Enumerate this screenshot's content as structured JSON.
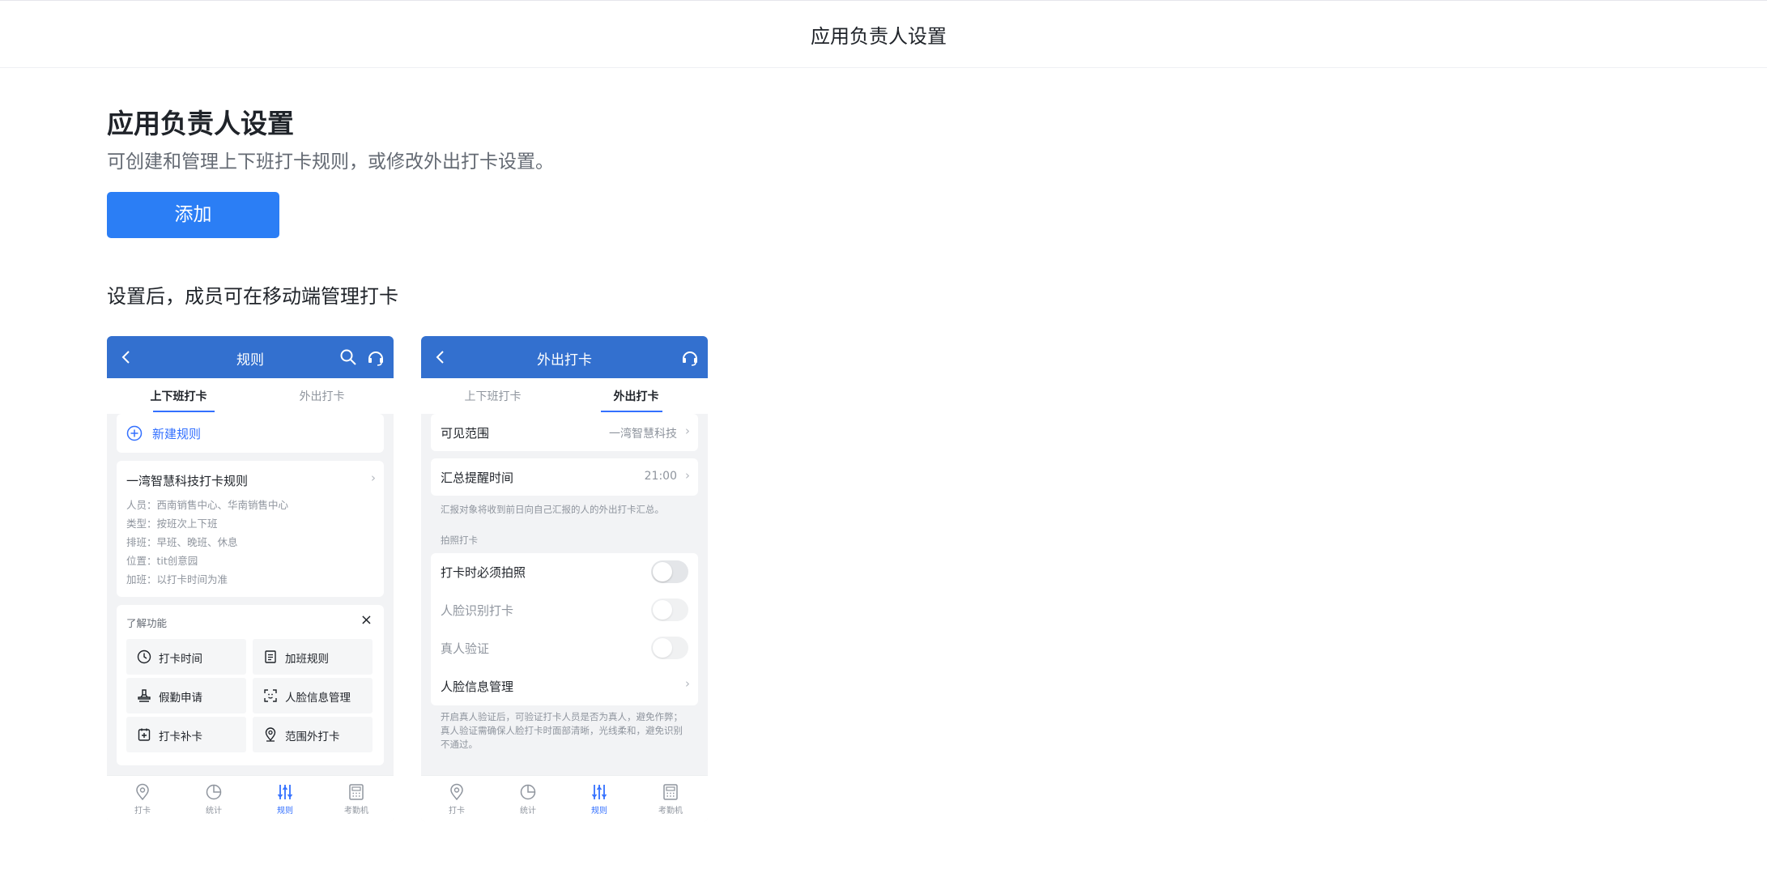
{
  "topbar": {
    "title": "应用负责人设置"
  },
  "page": {
    "title": "应用负责人设置",
    "description": "可创建和管理上下班打卡规则，或修改外出打卡设置。",
    "add_button": "添加",
    "section_note": "设置后，成员可在移动端管理打卡"
  },
  "phone1": {
    "header_title": "规则",
    "tabs": [
      "上下班打卡",
      "外出打卡"
    ],
    "new_rule": "新建规则",
    "rule": {
      "name": "一湾智慧科技打卡规则",
      "lines": [
        "人员：西南销售中心、华南销售中心",
        "类型：按班次上下班",
        "排班：早班、晚班、休息",
        "位置：tit创意园",
        "加班：以打卡时间为准"
      ]
    },
    "features": {
      "title": "了解功能",
      "close": "×",
      "items": [
        "打卡时间",
        "加班规则",
        "假勤申请",
        "人脸信息管理",
        "打卡补卡",
        "范围外打卡"
      ]
    }
  },
  "phone2": {
    "header_title": "外出打卡",
    "tabs": [
      "上下班打卡",
      "外出打卡"
    ],
    "visible_scope": {
      "label": "可见范围",
      "value": "一湾智慧科技"
    },
    "summary_time": {
      "label": "汇总提醒时间",
      "value": "21:00"
    },
    "summary_note": "汇报对象将收到前日向自己汇报的人的外出打卡汇总。",
    "photo_section": "拍照打卡",
    "toggles": [
      {
        "label": "打卡时必须拍照",
        "enabled": false
      },
      {
        "label": "人脸识别打卡",
        "enabled": false,
        "disabled": true
      },
      {
        "label": "真人验证",
        "enabled": false,
        "disabled": true
      }
    ],
    "face_manage": "人脸信息管理",
    "face_note": "开启真人验证后，可验证打卡人员是否为真人，避免作弊；真人验证需确保人脸打卡时面部清晰，光线柔和，避免识别不通过。"
  },
  "tabbar": [
    "打卡",
    "统计",
    "规则",
    "考勤机"
  ],
  "colors": {
    "primary": "#2b7ef5",
    "header": "#3370cf",
    "accent": "#3370ff"
  }
}
